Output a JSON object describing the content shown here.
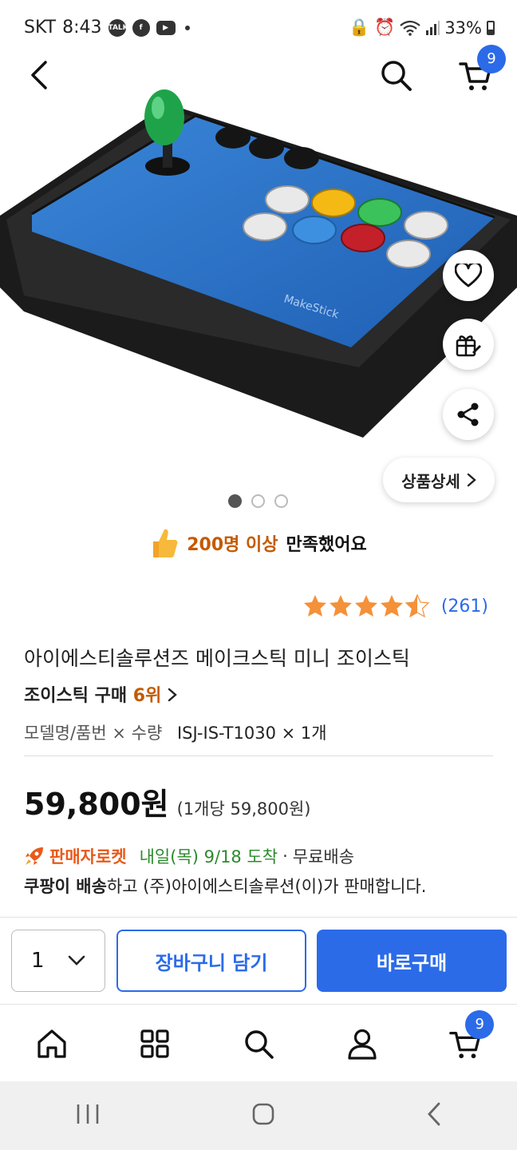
{
  "status_bar": {
    "carrier": "SKT",
    "time": "8:43",
    "talk_icon_text": "TALK",
    "battery": "33%"
  },
  "header": {
    "cart_count": "9"
  },
  "gallery": {
    "detail_label": "상품상세",
    "page_count": 3,
    "active_page": 1
  },
  "satisfaction": {
    "highlight": "200명 이상",
    "rest": "만족했어요"
  },
  "rating": {
    "stars": 4.5,
    "count": "(261)"
  },
  "product": {
    "title": "아이에스티솔루션즈 메이크스틱 미니 조이스틱",
    "rank_label": "조이스틱 구매",
    "rank_num": "6위",
    "option_label": "모델명/품번 × 수량",
    "option_value": "ISJ-IS-T1030 × 1개",
    "price": "59,800원",
    "unit_price": "(1개당 59,800원)"
  },
  "delivery": {
    "rocket_label": "판매자로켓",
    "arrival": "내일(목) 9/18 도착",
    "separator": "·",
    "shipping": "무료배송",
    "seller_bold": "쿠팡이 배송",
    "seller_rest": "하고 (주)아이에스티솔루션(이)가 판매합니다."
  },
  "purchase": {
    "quantity": "1",
    "add_to_cart": "장바구니 담기",
    "buy_now": "바로구매"
  },
  "bottom_nav": {
    "cart_count": "9"
  },
  "colors": {
    "primary": "#2b6be8",
    "accent_orange": "#c45a00",
    "arrival_green": "#2c8a2c",
    "star": "#f4913a"
  }
}
